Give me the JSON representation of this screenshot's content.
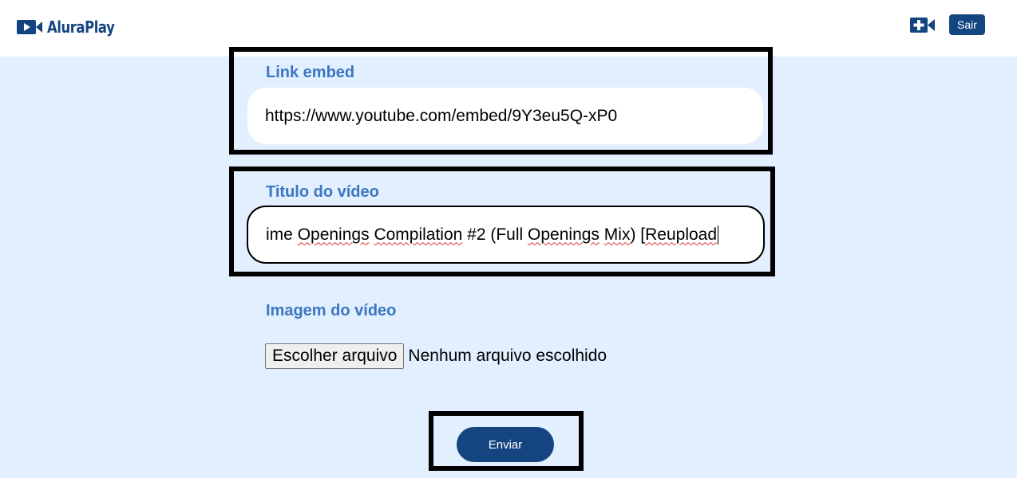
{
  "header": {
    "logo_text": "AluraPlay",
    "add_video_icon": "video-camera-plus-icon",
    "logout_label": "Sair",
    "brand_color": "#154580"
  },
  "form": {
    "link": {
      "label": "Link embed",
      "value": "https://www.youtube.com/embed/9Y3eu5Q-xP0"
    },
    "title": {
      "label": "Titulo do vídeo",
      "value_parts": [
        "ime ",
        "Openings",
        " ",
        "Compilation",
        " #2 (Full ",
        "Openings",
        " ",
        "Mix",
        ") [",
        "Reupload"
      ]
    },
    "image": {
      "label": "Imagem do vídeo",
      "choose_button": "Escolher arquivo",
      "status": "Nenhum arquivo escolhido"
    },
    "submit_label": "Enviar"
  },
  "colors": {
    "page_bg": "#e1efff",
    "label": "#3d76c2",
    "highlight_border": "#000000"
  }
}
